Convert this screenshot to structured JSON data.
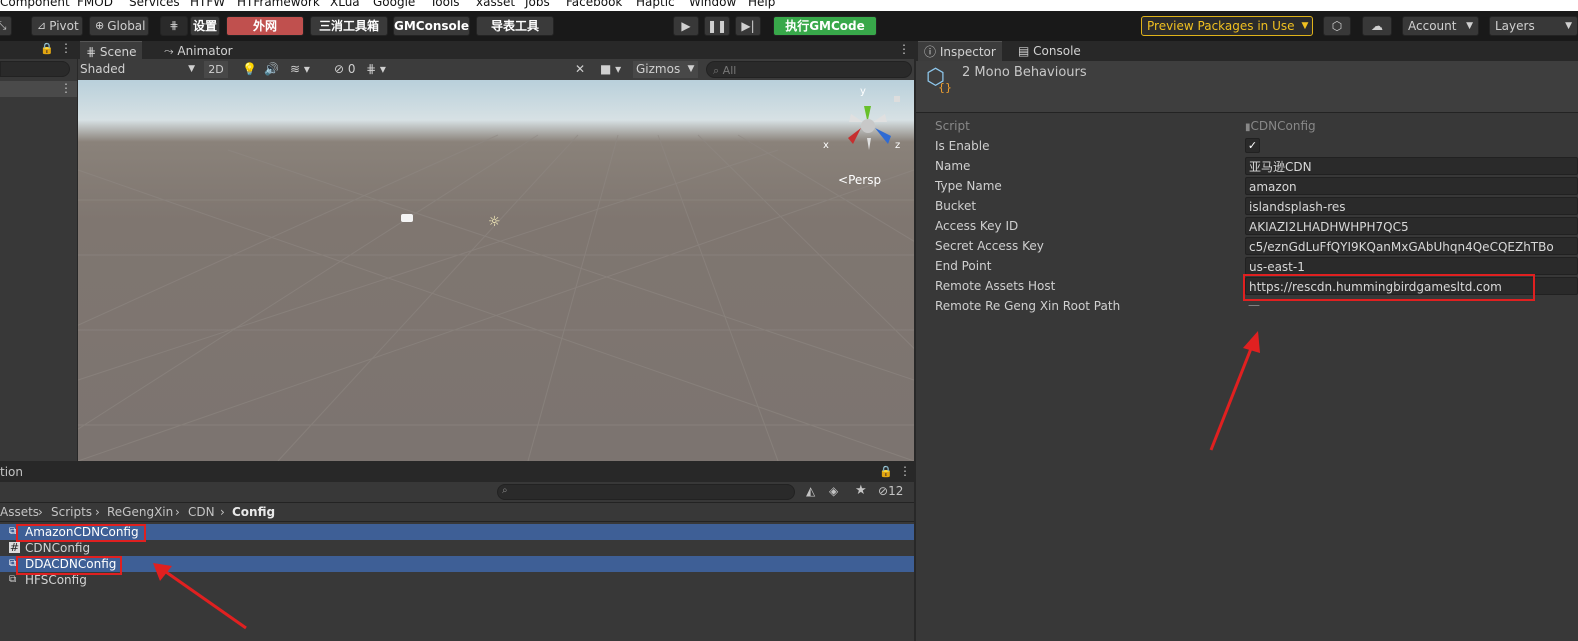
{
  "menu": [
    "Component",
    "FMOD",
    "Services",
    "HTFW",
    "HTFramework",
    "XLua",
    "Google",
    "Tools",
    "xasset",
    "Jobs",
    "Facebook",
    "Haptic",
    "Window",
    "Help"
  ],
  "toolbar": {
    "pivot": "Pivot",
    "global": "Global",
    "settings": "设置",
    "external_net": "外网",
    "match3_tools": "三消工具箱",
    "gmconsole": "GMConsole",
    "table_tools": "导表工具",
    "exec_gmcode": "执行GMCode",
    "preview_packages": "Preview Packages in Use",
    "account": "Account",
    "layers": "Layers",
    "colors": {
      "red": "#c0504e",
      "green": "#38a84a",
      "yellow": "#e0b31a"
    }
  },
  "scene": {
    "tab_scene": "Scene",
    "tab_animator": "Animator",
    "shading": "Shaded",
    "mode_2d": "2D",
    "hidden_count": "0",
    "gizmos": "Gizmos",
    "search_placeholder": "All",
    "persp": "Persp",
    "axis_y": "y",
    "axis_x": "x",
    "axis_z": "z"
  },
  "project": {
    "title": "tion",
    "hidden_count": "12",
    "breadcrumb": [
      "Assets",
      "Scripts",
      "ReGengXin",
      "CDN",
      "Config"
    ],
    "items": [
      {
        "label": "AmazonCDNConfig",
        "selected": true,
        "icon": "scriptable-object-icon"
      },
      {
        "label": "CDNConfig",
        "selected": false,
        "icon": "csharp-script-icon"
      },
      {
        "label": "DDACDNConfig",
        "selected": true,
        "icon": "scriptable-object-icon"
      },
      {
        "label": "HFSConfig",
        "selected": false,
        "icon": "scriptable-object-icon"
      }
    ]
  },
  "inspector": {
    "tab_inspector": "Inspector",
    "tab_console": "Console",
    "header": "2 Mono Behaviours",
    "fields": [
      {
        "label": "Script",
        "value": "CDNConfig"
      },
      {
        "label": "Is Enable",
        "value": "✓"
      },
      {
        "label": "Name",
        "value": "亚马逊CDN"
      },
      {
        "label": "Type Name",
        "value": "amazon"
      },
      {
        "label": "Bucket",
        "value": "islandsplash-res"
      },
      {
        "label": "Access Key ID",
        "value": "AKIAZI2LHADHWHPH7QC5"
      },
      {
        "label": "Secret Access Key",
        "value": "c5/eznGdLuFfQYI9KQanMxGAbUhqn4QeCQEZhTBo"
      },
      {
        "label": "End Point",
        "value": "us-east-1"
      },
      {
        "label": "Remote Assets Host",
        "value": "https://rescdn.hummingbirdgamesltd.com"
      },
      {
        "label": "Remote Re Geng Xin Root Path",
        "value": "—"
      }
    ]
  }
}
